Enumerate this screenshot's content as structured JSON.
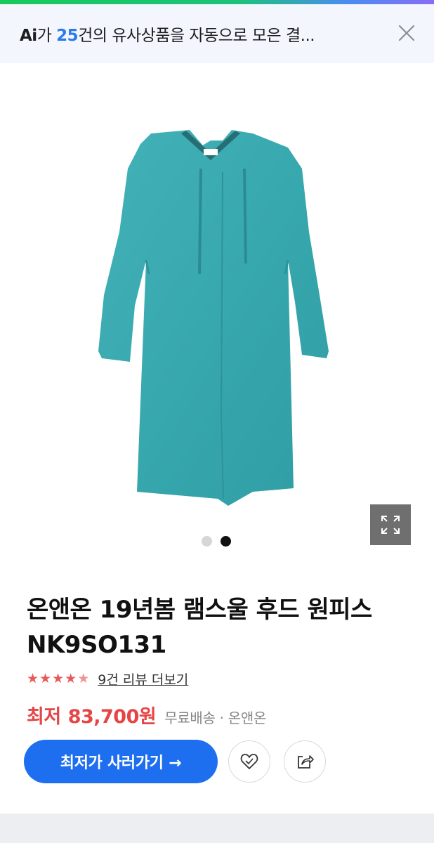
{
  "ai_banner": {
    "logo": "Ai",
    "text_before_count": "가 ",
    "count": "25",
    "text_after_count": "건의 유사상품을 자동으로 모은 결...",
    "close_icon": "close-icon"
  },
  "gallery": {
    "image_alt": "teal knit hooded dress",
    "dress_color": "#3aa9b0",
    "dots_total": 2,
    "active_dot": 2,
    "expand_icon": "expand-icon"
  },
  "product": {
    "title": "온앤온 19년봄 램스울 후드 원피스 NK9SO131",
    "rating": 4.5,
    "star_color": "#e85a5a",
    "review_link": "9건 리뷰 더보기",
    "price_label": "최저",
    "price": "83,700원",
    "shipping_seller": "무료배송 · 온앤온",
    "price_color": "#e64545"
  },
  "actions": {
    "buy_label": "최저가 사러가기 →",
    "buy_color": "#1e6ff0",
    "wish_icon": "heart-icon",
    "share_icon": "share-icon"
  }
}
